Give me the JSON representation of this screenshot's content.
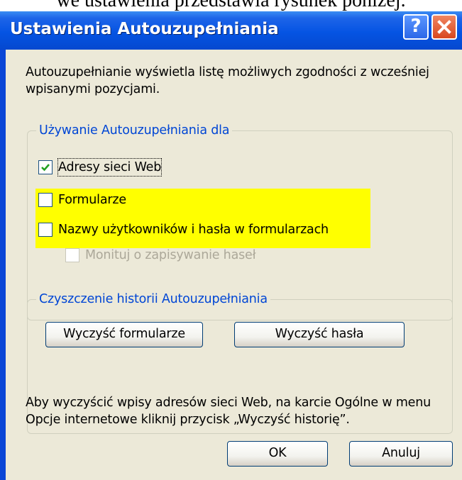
{
  "caption": {
    "text": "we ustawienia przedstawia rysunek poniżej."
  },
  "window": {
    "title": "Ustawienia Autouzupełniania",
    "help_glyph": "?",
    "close_icon": "close-x-icon",
    "colors": {
      "titlebar": "#0554e3",
      "client": "#ece9d8",
      "group_title": "#0046d5",
      "highlight": "#ffff00",
      "close_button": "#d8471e",
      "disabled_text": "#aca899"
    }
  },
  "description": "Autouzupełnianie wyświetla listę możliwych zgodności z wcześniej wpisanymi pozycjami.",
  "usage_group": {
    "title": "Używanie Autouzupełniania dla",
    "options": [
      {
        "label": "Adresy sieci Web",
        "checked": true,
        "enabled": true
      },
      {
        "label": "Formularze",
        "checked": false,
        "enabled": true
      },
      {
        "label": "Nazwy użytkowników i hasła w formularzach",
        "checked": false,
        "enabled": true
      },
      {
        "label": "Monituj o zapisywanie haseł",
        "checked": false,
        "enabled": false
      }
    ]
  },
  "clear_group": {
    "title": "Czyszczenie historii Autouzupełniania",
    "clear_forms_label": "Wyczyść formularze",
    "clear_passwords_label": "Wyczyść hasła",
    "info": "Aby wyczyścić wpisy adresów sieci Web, na karcie Ogólne w menu Opcje internetowe kliknij przycisk „Wyczyść historię”."
  },
  "footer": {
    "ok_label": "OK",
    "cancel_label": "Anuluj"
  }
}
